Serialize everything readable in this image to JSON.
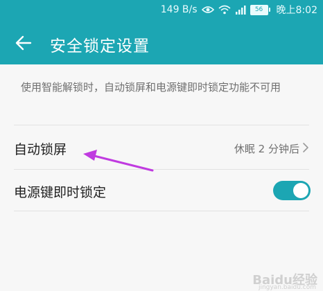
{
  "status_bar": {
    "speed": "149 B/s",
    "battery": "56",
    "time": "晚上8:02"
  },
  "header": {
    "title": "安全锁定设置"
  },
  "notice": "使用智能解锁时，自动锁屏和电源键即时锁定功能不可用",
  "settings": [
    {
      "label": "自动锁屏",
      "value": "休眠 2 分钟后"
    },
    {
      "label": "电源键即时锁定",
      "toggle_on": true
    }
  ],
  "colors": {
    "accent": "#1ca6b3",
    "annotation_arrow": "#c03be0"
  },
  "watermark": {
    "brand": "Baidu经验",
    "url": "jingyan.baidu.com"
  }
}
